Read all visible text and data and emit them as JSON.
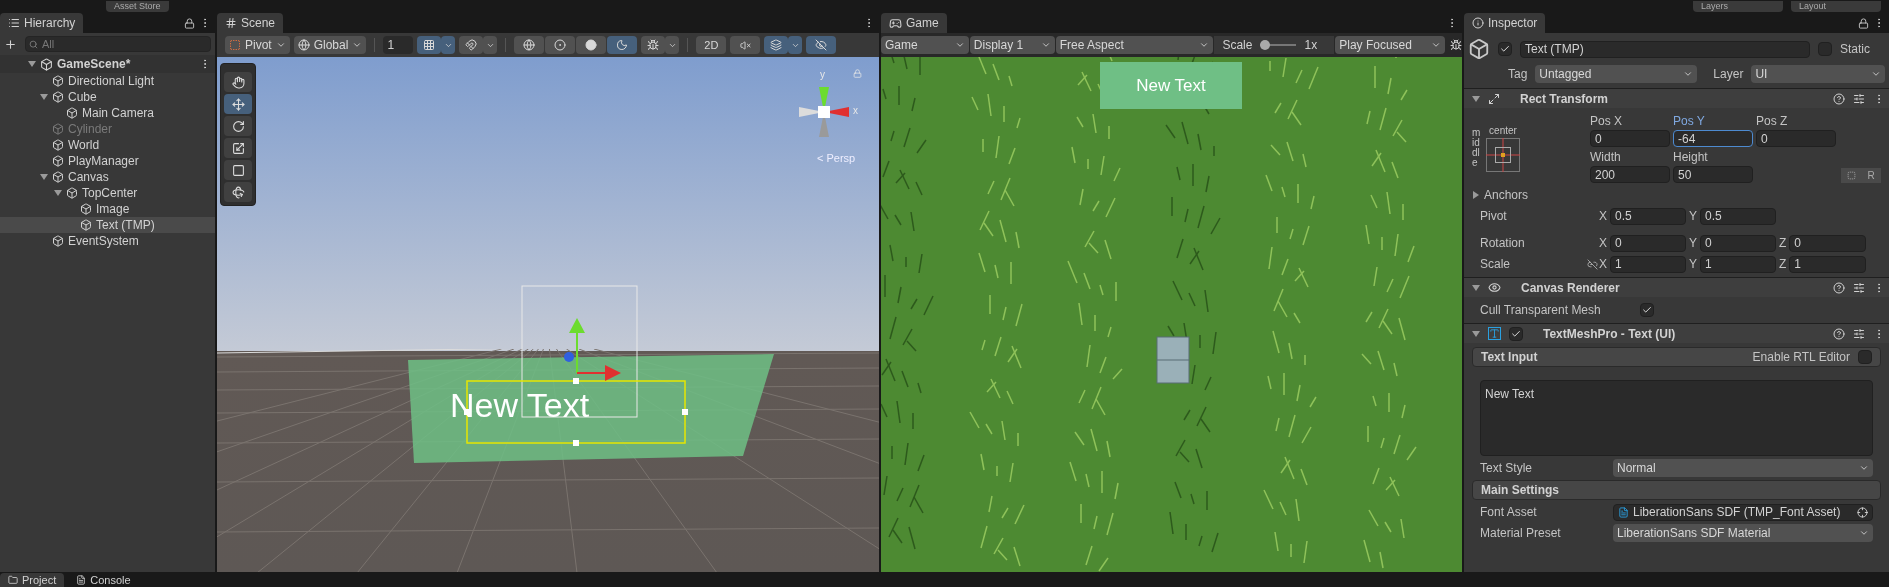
{
  "top_bar": {
    "asset_store": "Asset Store",
    "layers": "Layers",
    "layout": "Layout"
  },
  "hierarchy": {
    "title": "Hierarchy",
    "search": {
      "placeholder": "All"
    },
    "scene": {
      "name": "GameScene*",
      "expanded": true
    },
    "items": [
      {
        "name": "Directional Light",
        "active": true,
        "selected": false
      },
      {
        "name": "Cube",
        "active": true,
        "selected": false,
        "expanded": true,
        "children": [
          {
            "name": "Main Camera",
            "active": true,
            "selected": false
          }
        ]
      },
      {
        "name": "Cylinder",
        "active": false,
        "selected": false
      },
      {
        "name": "World",
        "active": true,
        "selected": false
      },
      {
        "name": "PlayManager",
        "active": true,
        "selected": false
      },
      {
        "name": "Canvas",
        "active": true,
        "selected": false,
        "expanded": true,
        "children": [
          {
            "name": "TopCenter",
            "active": true,
            "selected": false,
            "expanded": true,
            "children": [
              {
                "name": "Image",
                "active": true,
                "selected": false
              },
              {
                "name": "Text (TMP)",
                "active": true,
                "selected": true
              }
            ]
          }
        ]
      },
      {
        "name": "EventSystem",
        "active": true,
        "selected": false
      }
    ]
  },
  "scene_view": {
    "title": "Scene",
    "toolbar": {
      "pivot": "Pivot",
      "space": "Global",
      "grid_size": "1",
      "snapping": [
        {
          "kind": "grid",
          "on": true
        },
        {
          "kind": "snap",
          "on": false
        }
      ],
      "draw_modes": [
        {
          "kind": "wireframe",
          "selected": false
        },
        {
          "kind": "shaded-wireframe",
          "selected": false
        },
        {
          "kind": "shaded",
          "selected": false
        },
        {
          "kind": "unlit",
          "selected": true
        }
      ],
      "gizmos": {
        "on": false
      },
      "mode_2d": {
        "label": "2D",
        "on": false
      },
      "audio": {
        "on": false
      },
      "effects": {
        "on": true
      },
      "visibility": {
        "on": true
      }
    },
    "tools": [
      {
        "kind": "hand",
        "selected": false
      },
      {
        "kind": "move",
        "selected": true
      },
      {
        "kind": "rotate",
        "selected": false
      },
      {
        "kind": "scale",
        "selected": false
      },
      {
        "kind": "rect",
        "selected": false
      },
      {
        "kind": "transform",
        "selected": false
      }
    ],
    "gizmo_axes": [
      "y",
      "x"
    ],
    "projection_prefix": "<",
    "projection": "Persp",
    "canvas_text": "New Text"
  },
  "game_view": {
    "title": "Game",
    "toolbar": {
      "mode": "Game",
      "display": "Display 1",
      "aspect": "Free Aspect",
      "scale_label": "Scale",
      "scale": {
        "level": 0
      },
      "scale_value": "1x",
      "play_mode": "Play Focused"
    },
    "ui_text": "New Text"
  },
  "inspector": {
    "title": "Inspector",
    "object": {
      "active": true,
      "name": "Text (TMP)",
      "static": false,
      "static_label": "Static",
      "tag_label": "Tag",
      "tag": "Untagged",
      "layer_label": "Layer",
      "layer": "UI"
    },
    "rect_transform": {
      "title": "Rect Transform",
      "expanded": true,
      "anchor_h": "center",
      "anchor_v": "middle",
      "row1": [
        {
          "label": "Pos X",
          "value": "0",
          "focused": false
        },
        {
          "label": "Pos Y",
          "value": "-64",
          "focused": true
        },
        {
          "label": "Pos Z",
          "value": "0",
          "focused": false
        }
      ],
      "row2": [
        {
          "label": "Width",
          "value": "200",
          "focused": false
        },
        {
          "label": "Height",
          "value": "50",
          "focused": false
        }
      ],
      "raw_button": "R",
      "anchors": {
        "label": "Anchors",
        "expanded": false
      },
      "vectors": [
        {
          "label": "Pivot",
          "axes": [
            {
              "axis": "X",
              "value": "0.5"
            },
            {
              "axis": "Y",
              "value": "0.5"
            }
          ]
        },
        {
          "label": "Rotation",
          "axes": [
            {
              "axis": "X",
              "value": "0"
            },
            {
              "axis": "Y",
              "value": "0"
            },
            {
              "axis": "Z",
              "value": "0"
            }
          ]
        },
        {
          "label": "Scale",
          "axes": [
            {
              "axis": "X",
              "value": "1"
            },
            {
              "axis": "Y",
              "value": "1"
            },
            {
              "axis": "Z",
              "value": "1"
            }
          ]
        }
      ]
    },
    "canvas_renderer": {
      "title": "Canvas Renderer",
      "expanded": true,
      "cull_label": "Cull Transparent Mesh",
      "cull": true
    },
    "tmp": {
      "title": "TextMeshPro - Text (UI)",
      "enabled": true,
      "expanded": true,
      "text_input": {
        "title": "Text Input",
        "rtl_label": "Enable RTL Editor",
        "rtl": false,
        "value": "New Text"
      },
      "text_style": {
        "label": "Text Style",
        "value": "Normal"
      },
      "main_settings": {
        "title": "Main Settings",
        "rows": [
          {
            "kind": "object",
            "label": "Font Asset",
            "value": "LiberationSans SDF (TMP_Font Asset)"
          },
          {
            "kind": "dropdown",
            "label": "Material Preset",
            "value": "LiberationSans SDF Material"
          }
        ]
      }
    }
  },
  "bottom_tabs": [
    {
      "label": "Project",
      "selected": true
    },
    {
      "label": "Console",
      "selected": false
    }
  ]
}
